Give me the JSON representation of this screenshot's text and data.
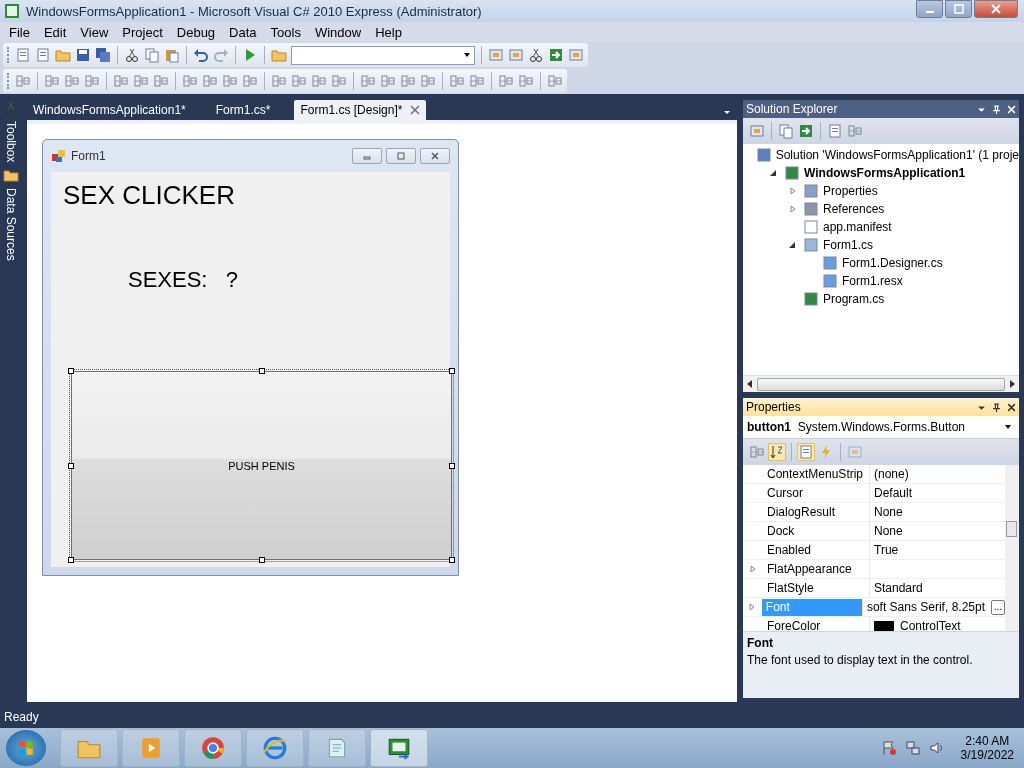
{
  "window": {
    "title": "WindowsFormsApplication1 - Microsoft Visual C# 2010 Express (Administrator)"
  },
  "menu": [
    "File",
    "Edit",
    "View",
    "Project",
    "Debug",
    "Data",
    "Tools",
    "Window",
    "Help"
  ],
  "side_tabs": [
    "Toolbox",
    "Data Sources"
  ],
  "document_tabs": [
    {
      "label": "WindowsFormsApplication1*",
      "selected": false
    },
    {
      "label": "Form1.cs*",
      "selected": false
    },
    {
      "label": "Form1.cs [Design]*",
      "selected": true
    }
  ],
  "designer": {
    "form": {
      "title": "Form1",
      "labels": [
        {
          "text": "SEX CLICKER",
          "kind": "title"
        },
        {
          "text": "SEXES:   ?",
          "kind": "counter"
        }
      ],
      "button": {
        "label": "PUSH PENIS",
        "selected": true
      }
    }
  },
  "solution_explorer": {
    "title": "Solution Explorer",
    "tree": [
      {
        "label": "Solution 'WindowsFormsApplication1' (1 proje",
        "kind": "solution",
        "children": [
          {
            "label": "WindowsFormsApplication1",
            "kind": "project",
            "expanded": true,
            "children": [
              {
                "label": "Properties",
                "kind": "folder",
                "expanded": false
              },
              {
                "label": "References",
                "kind": "references",
                "expanded": false
              },
              {
                "label": "app.manifest",
                "kind": "file"
              },
              {
                "label": "Form1.cs",
                "kind": "form",
                "expanded": true,
                "children": [
                  {
                    "label": "Form1.Designer.cs",
                    "kind": "code"
                  },
                  {
                    "label": "Form1.resx",
                    "kind": "code"
                  }
                ]
              },
              {
                "label": "Program.cs",
                "kind": "csharp"
              }
            ]
          }
        ]
      }
    ]
  },
  "properties": {
    "title": "Properties",
    "object_name": "button1",
    "object_type": "System.Windows.Forms.Button",
    "rows": [
      {
        "name": "ContextMenuStrip",
        "value": "(none)",
        "expandable": false,
        "selected": false
      },
      {
        "name": "Cursor",
        "value": "Default",
        "expandable": false,
        "selected": false
      },
      {
        "name": "DialogResult",
        "value": "None",
        "expandable": false,
        "selected": false
      },
      {
        "name": "Dock",
        "value": "None",
        "expandable": false,
        "selected": false
      },
      {
        "name": "Enabled",
        "value": "True",
        "expandable": false,
        "selected": false
      },
      {
        "name": "FlatAppearance",
        "value": "",
        "expandable": true,
        "selected": false
      },
      {
        "name": "FlatStyle",
        "value": "Standard",
        "expandable": false,
        "selected": false
      },
      {
        "name": "Font",
        "value": "soft Sans Serif, 8.25pt",
        "expandable": true,
        "selected": true,
        "button": "..."
      },
      {
        "name": "ForeColor",
        "value": "ControlText",
        "expandable": false,
        "selected": false,
        "color": "#000000"
      }
    ],
    "description": {
      "title": "Font",
      "text": "The font used to display text in the control."
    }
  },
  "status_bar": "Ready",
  "taskbar": {
    "time": "2:40 AM",
    "date": "3/19/2022"
  }
}
